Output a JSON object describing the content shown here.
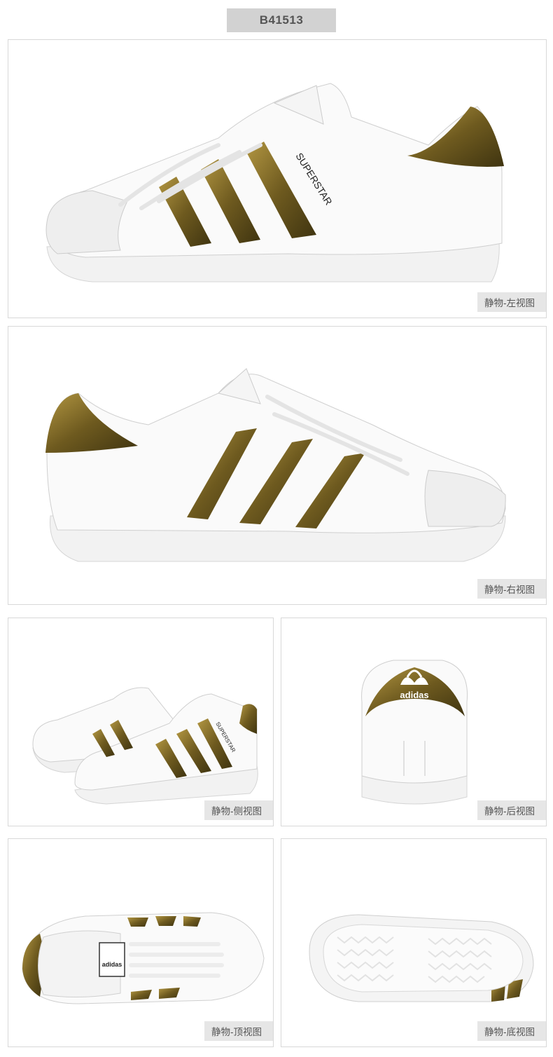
{
  "product_code": "B41513",
  "colors": {
    "gold": "#6e5a1f",
    "gold_light": "#a4883b",
    "caption_bg": "#e6e6e6",
    "code_bg": "#d2d2d2"
  },
  "views": [
    {
      "caption": "静物-左视图",
      "shoe_text": "SUPERSTAR"
    },
    {
      "caption": "静物-右视图"
    },
    {
      "caption": "静物-侧视图",
      "shoe_text": "SUPERSTAR"
    },
    {
      "caption": "静物-后视图",
      "shoe_text": "adidas"
    },
    {
      "caption": "静物-顶视图",
      "shoe_text": "adidas"
    },
    {
      "caption": "静物-底视图"
    }
  ]
}
